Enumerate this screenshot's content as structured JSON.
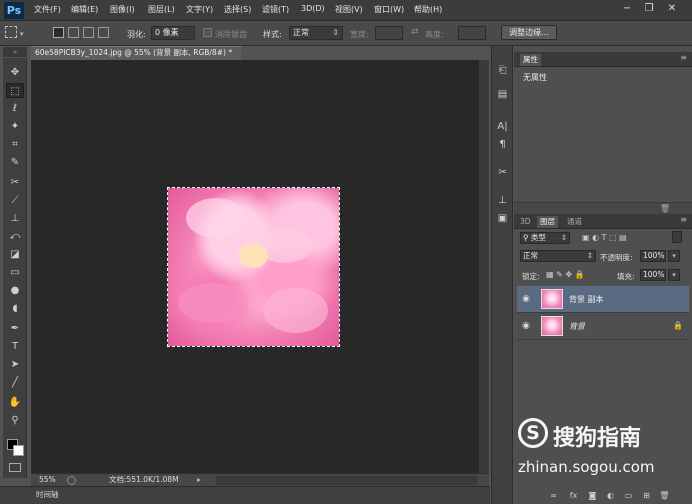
{
  "app": {
    "logo": "Ps"
  },
  "menu": [
    "文件(F)",
    "编辑(E)",
    "图像(I)",
    "图层(L)",
    "文字(Y)",
    "选择(S)",
    "滤镜(T)",
    "3D(D)",
    "视图(V)",
    "窗口(W)",
    "帮助(H)"
  ],
  "window_controls": {
    "minimize": "−",
    "restore": "❐",
    "close": "✕"
  },
  "options": {
    "feather_label": "羽化:",
    "feather_value": "0 像素",
    "antialias_label": "消除锯齿",
    "style_label": "样式:",
    "style_value": "正常",
    "width_label": "宽度:",
    "height_label": "高度:",
    "refine_edge_button": "调整边缘..."
  },
  "document": {
    "tab_title": "60e58PICB3y_1024.jpg @ 55% (背景 副本, RGB/8#) *",
    "zoom": "55%",
    "doc_size": "文档:551.0K/1.08M"
  },
  "timeline_label": "时间轴",
  "properties": {
    "tab": "属性",
    "empty_text": "无属性"
  },
  "layers_panel": {
    "tabs": [
      "3D",
      "图层",
      "通道"
    ],
    "filter_kind": "类型",
    "blend_mode": "正常",
    "opacity_label": "不透明度:",
    "opacity_value": "100%",
    "lock_label": "锁定:",
    "fill_label": "填充:",
    "fill_value": "100%",
    "layers": [
      {
        "name": "背景 副本",
        "selected": true
      },
      {
        "name": "背景",
        "selected": false
      }
    ]
  },
  "watermark": {
    "logo": "S",
    "brand": "搜狗指南",
    "url": "zhinan.sogou.com"
  },
  "colors": {
    "selected_layer": "#5a6a80",
    "canvas_bg": "#282828",
    "foreground": "#000000",
    "background": "#ffffff"
  }
}
